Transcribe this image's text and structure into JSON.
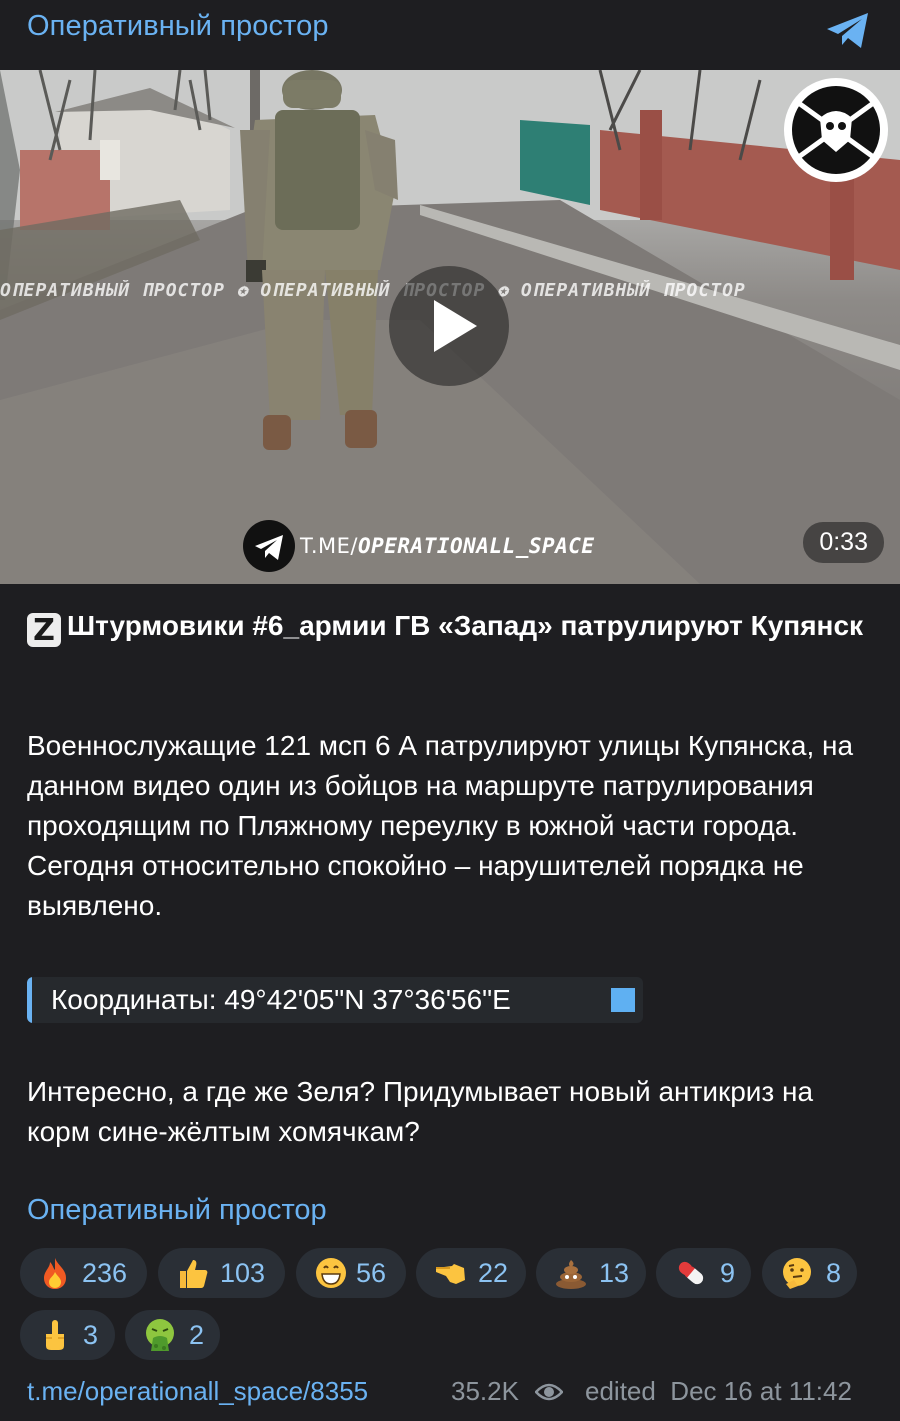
{
  "channel": {
    "title": "Оперативный простор",
    "share_icon": "telegram-plane-icon"
  },
  "video": {
    "duration": "0:33",
    "watermark_text": "ОПЕРАТИВНЫЙ ПРОСТОР",
    "tme_prefix": "T.ME/",
    "tme_handle": "OPERATIONALL_SPACE",
    "play_icon": "play-icon"
  },
  "post": {
    "z_badge": "Z",
    "headline": "Штурмовики #6_армии ГВ «Запад» патрулируют Купянск",
    "paragraph1": "Военнослужащие 121 мсп 6 А патрулируют улицы Купянска, на данном видео один из бойцов на маршруте патрулирования проходящим по Пляжному переулку в южной части города. Сегодня относительно спокойно – нарушителей порядка не выявлено.",
    "coordinates": "Координаты: 49°42'05\"N 37°36'56\"E",
    "paragraph2": "Интересно, а где же Зеля? Придумывает новый антикриз на корм сине-жёлтым хомячкам?",
    "signature": "Оперативный простор"
  },
  "reactions": [
    {
      "icon": "fire-icon",
      "count": "236"
    },
    {
      "icon": "thumbs-up-icon",
      "count": "103"
    },
    {
      "icon": "grinning-face-icon",
      "count": "56"
    },
    {
      "icon": "pointing-hand-icon",
      "count": "22"
    },
    {
      "icon": "poop-icon",
      "count": "13"
    },
    {
      "icon": "pill-icon",
      "count": "9"
    },
    {
      "icon": "thinking-face-icon",
      "count": "8"
    },
    {
      "icon": "middle-finger-icon",
      "count": "3"
    },
    {
      "icon": "vomiting-face-icon",
      "count": "2"
    }
  ],
  "footer": {
    "link": "t.me/operationall_space/8355",
    "views": "35.2K",
    "edited": "edited  Dec 16 at 11:42"
  },
  "colors": {
    "accent": "#6ab2f2",
    "background": "#1e1e21",
    "muted": "#8d959d",
    "reaction_bg": "#2a2f36"
  }
}
